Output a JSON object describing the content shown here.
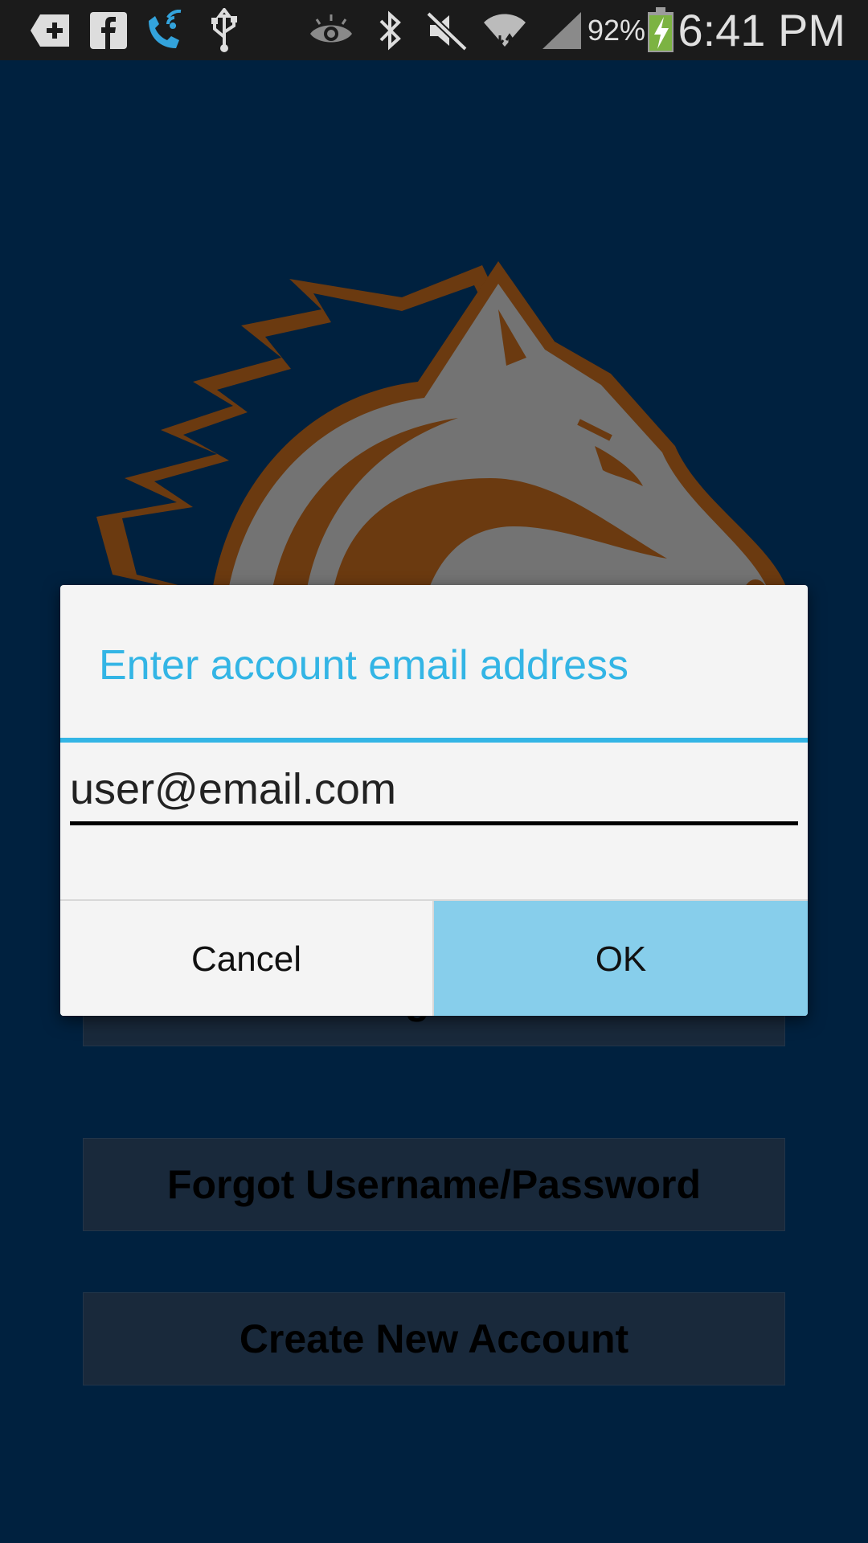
{
  "status_bar": {
    "icons": [
      "add-box-icon",
      "facebook-icon",
      "wifi-calling-icon",
      "usb-icon",
      "eye-icon",
      "bluetooth-icon",
      "mute-icon",
      "wifi-icon",
      "signal-icon",
      "battery-charging-icon"
    ],
    "battery_percent": "92%",
    "time": "6:41 PM"
  },
  "app": {
    "logo": "horse-head-logo",
    "buttons": {
      "sign_in": "Sign in",
      "forgot": "Forgot Username/Password",
      "create_account": "Create New Account"
    }
  },
  "dialog": {
    "title": "Enter account email address",
    "email_value": "user@email.com",
    "cancel_label": "Cancel",
    "ok_label": "OK"
  },
  "colors": {
    "accent": "#33b5e5",
    "ok_button": "#87ceeb",
    "background": "#00213f",
    "logo_brown": "#6b3a10",
    "logo_gray": "#737373"
  }
}
